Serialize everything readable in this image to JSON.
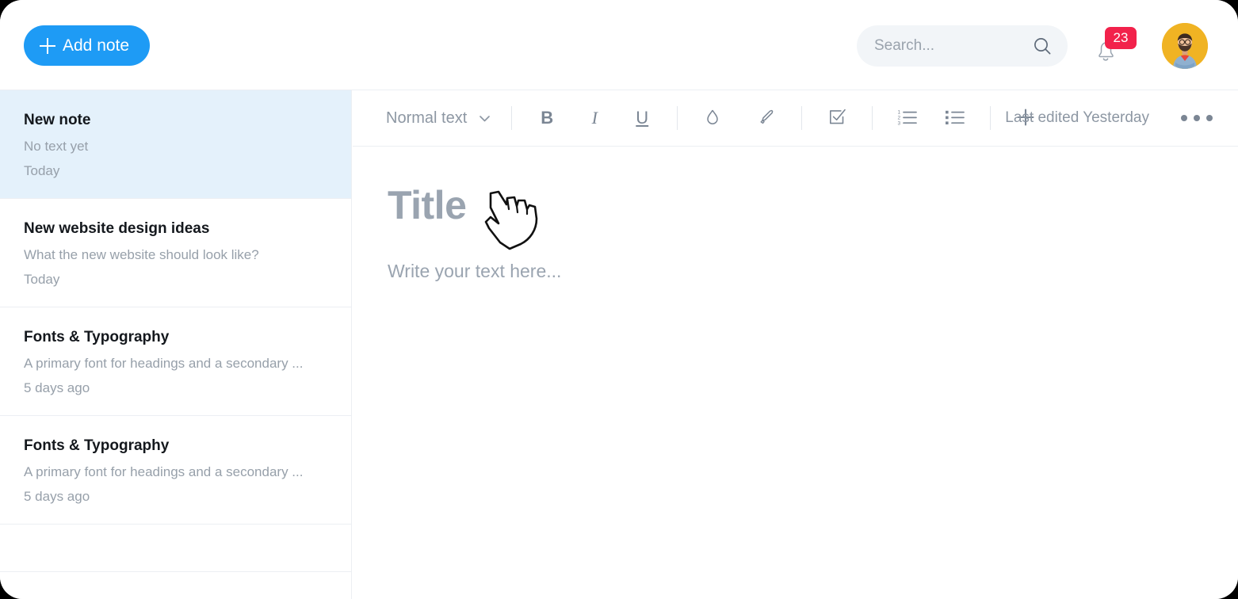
{
  "header": {
    "add_note_label": "Add note",
    "add_note_icon": "plus-icon",
    "accent_color": "#1e9bf5",
    "search": {
      "placeholder": "Search...",
      "value": "",
      "icon": "search-icon"
    },
    "notifications": {
      "icon": "bell-icon",
      "count": "23",
      "badge_color": "#f2224b"
    },
    "avatar": {
      "icon": "avatar",
      "background_color": "#f0b323"
    }
  },
  "sidebar": {
    "notes": [
      {
        "title": "New note",
        "snippet": "No text yet",
        "date": "Today",
        "selected": true
      },
      {
        "title": "New website design ideas",
        "snippet": "What the new website should look like?",
        "date": "Today",
        "selected": false
      },
      {
        "title": "Fonts & Typography",
        "snippet": "A primary font for headings and a secondary ...",
        "date": "5 days ago",
        "selected": false
      },
      {
        "title": "Fonts & Typography",
        "snippet": "A primary font for headings and a secondary ...",
        "date": "5 days ago",
        "selected": false
      }
    ],
    "selected_background": "#e4f1fb"
  },
  "editor": {
    "toolbar": {
      "style_label": "Normal text",
      "style_chevron": "chevron-down-icon",
      "bold_label": "B",
      "italic_label": "I",
      "underline_label": "U",
      "text_color_icon": "water-drop-icon",
      "highlighter_icon": "highlighter-pen-icon",
      "checklist_icon": "checkbox-checked-icon",
      "numbered_list_icon": "numbered-list-icon",
      "bulleted_list_icon": "bulleted-list-icon",
      "insert_icon": "plus-icon",
      "last_edited": "Last edited Yesterday",
      "more_icon": "three-dots-icon"
    },
    "document": {
      "title_placeholder": "Title",
      "body_placeholder": "Write your text here..."
    }
  },
  "cursor": {
    "icon": "pointing-hand-cursor"
  }
}
